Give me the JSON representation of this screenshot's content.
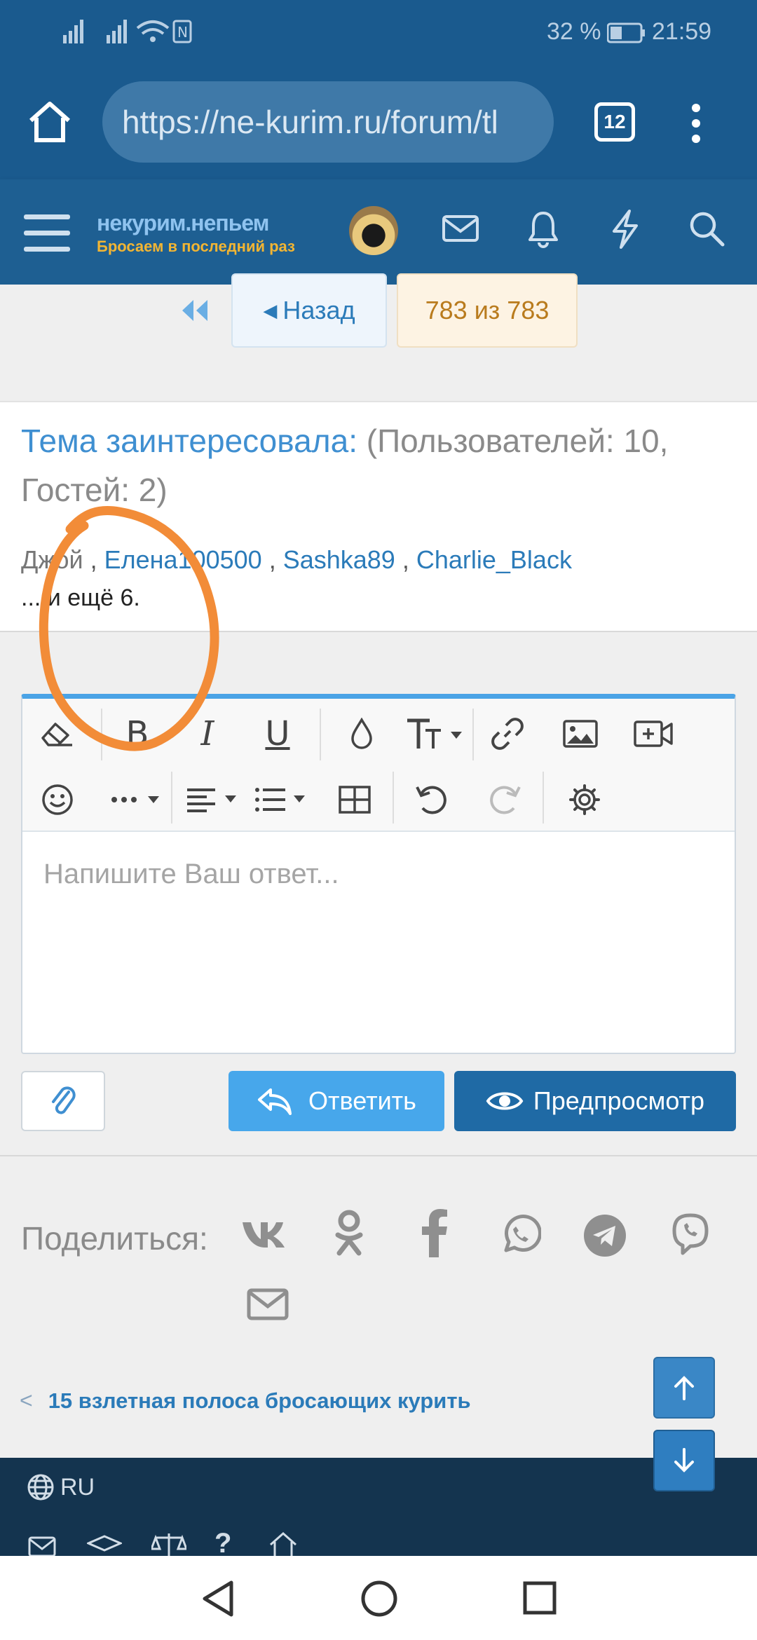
{
  "status_bar": {
    "battery_pct": "32 %",
    "time": "21:59"
  },
  "browser": {
    "url": "https://ne-kurim.ru/forum/tl",
    "tab_count": "12"
  },
  "site": {
    "logo_title": "некурим.непьем",
    "logo_tagline": "Бросаем в последний раз"
  },
  "pagination": {
    "back_label": "Назад",
    "page_label": "783 из 783"
  },
  "viewers": {
    "heading_link": "Тема заинтересовала:",
    "heading_counts": "(Пользователей: 10, Гостей: 2)",
    "users": [
      "Джой",
      "Елена100500",
      "Sashka89",
      "Charlie_Black"
    ],
    "more": "... и ещё 6."
  },
  "editor": {
    "placeholder": "Напишите Ваш ответ..."
  },
  "actions": {
    "reply_label": "Ответить",
    "preview_label": "Предпросмотр"
  },
  "share": {
    "label": "Поделиться:"
  },
  "thread_nav": {
    "prev_thread": "15 взлетная полоса бросающих курить"
  },
  "footer": {
    "language": "RU"
  },
  "colors": {
    "header_bg": "#1a5a8e",
    "link": "#2b7bb9",
    "reply_btn": "#47a7eb",
    "preview_btn": "#1f6aa5",
    "annotation": "#f28c38"
  }
}
